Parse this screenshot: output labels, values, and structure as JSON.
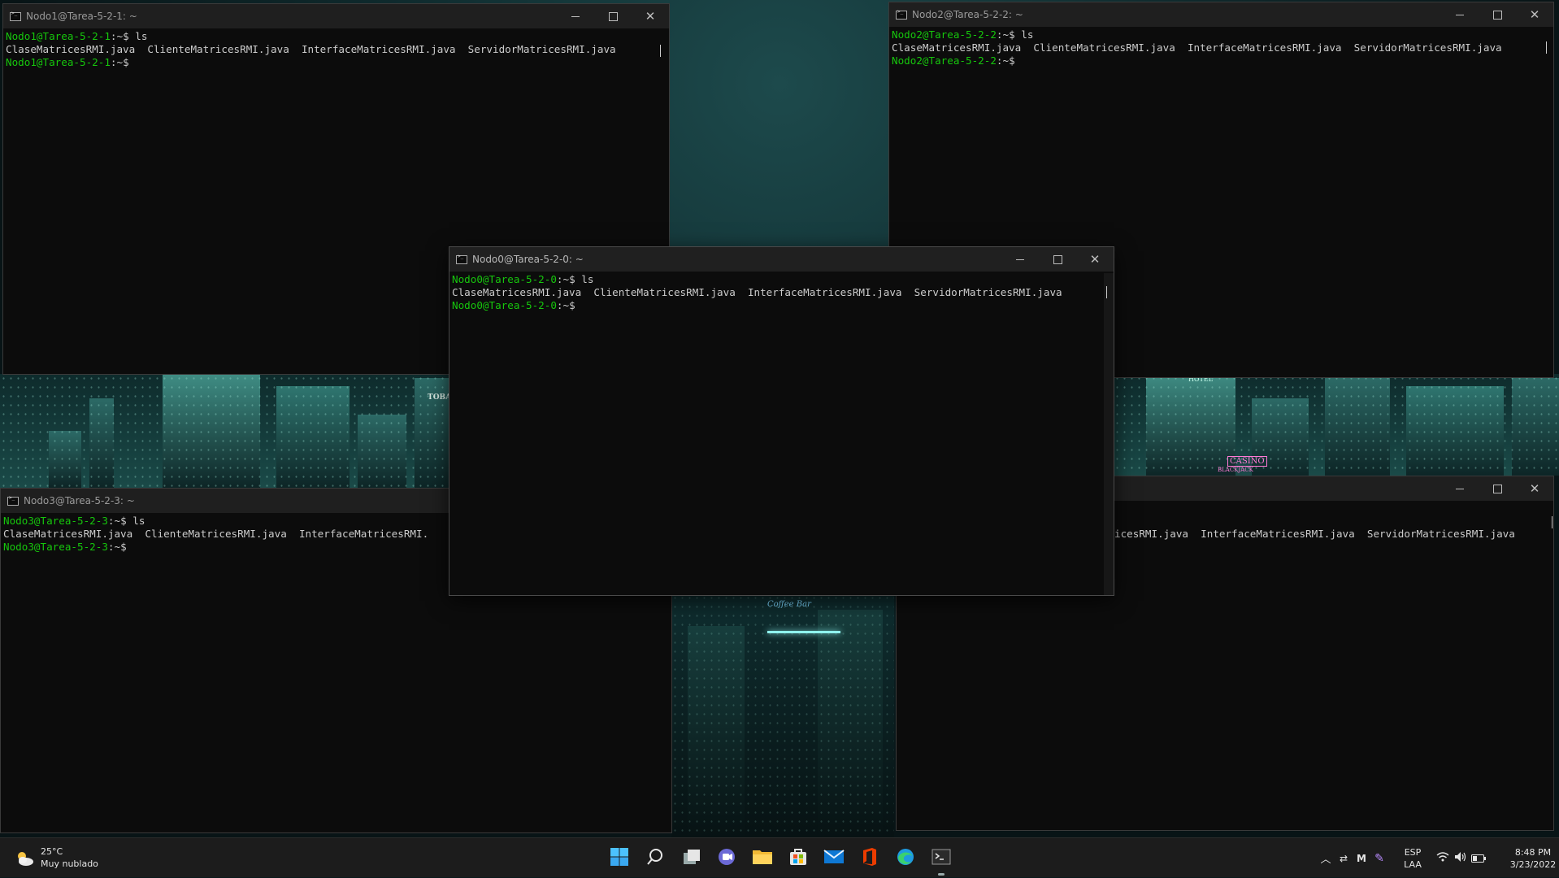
{
  "windows": {
    "nodo1": {
      "title": "Nodo1@Tarea-5-2-1: ~",
      "prompt_user": "Nodo1@Tarea-5-2-1",
      "prompt_sep": ":~$ ",
      "command": "ls",
      "listing": "ClaseMatricesRMI.java  ClienteMatricesRMI.java  InterfaceMatricesRMI.java  ServidorMatricesRMI.java",
      "prompt_end": ":~$"
    },
    "nodo2": {
      "title": "Nodo2@Tarea-5-2-2: ~",
      "prompt_user": "Nodo2@Tarea-5-2-2",
      "prompt_sep": ":~$ ",
      "command": "ls",
      "listing": "ClaseMatricesRMI.java  ClienteMatricesRMI.java  InterfaceMatricesRMI.java  ServidorMatricesRMI.java",
      "prompt_end": ":~$"
    },
    "nodo0": {
      "title": "Nodo0@Tarea-5-2-0: ~",
      "prompt_user": "Nodo0@Tarea-5-2-0",
      "prompt_sep": ":~$ ",
      "command": "ls",
      "listing": "ClaseMatricesRMI.java  ClienteMatricesRMI.java  InterfaceMatricesRMI.java  ServidorMatricesRMI.java",
      "prompt_end": ":~$"
    },
    "nodo3": {
      "title": "Nodo3@Tarea-5-2-3: ~",
      "prompt_user": "Nodo3@Tarea-5-2-3",
      "prompt_sep": ":~$ ",
      "command": "ls",
      "listing": "ClaseMatricesRMI.java  ClienteMatricesRMI.java  InterfaceMatricesRMI.",
      "prompt_end": ":~$"
    },
    "nodo4": {
      "listing": "icesRMI.java  InterfaceMatricesRMI.java  ServidorMatricesRMI.java"
    }
  },
  "wallpaper": {
    "sign_tobacco": "TOBAC",
    "sign_hotel": "HOTEL",
    "sign_casino": "CASINO",
    "sign_blackjack": "BLACKJACK",
    "sign_coffee": "Coffee Bar"
  },
  "taskbar": {
    "temperature": "25°C",
    "weather": "Muy nublado",
    "language": "ESP",
    "layout": "LAA",
    "time": "8:48 PM",
    "date": "3/23/2022"
  },
  "colors": {
    "prompt": "#16c60c",
    "terminal_bg": "#0c0c0c",
    "text": "#cccccc"
  },
  "icons": [
    "start-icon",
    "search-icon",
    "task-view-icon",
    "chat-icon",
    "file-explorer-icon",
    "store-icon",
    "mail-icon",
    "office-icon",
    "edge-icon",
    "terminal-icon"
  ]
}
